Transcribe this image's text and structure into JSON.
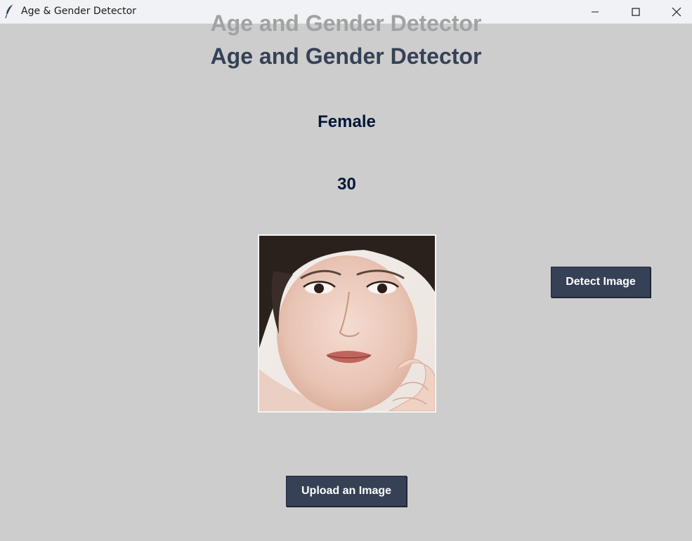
{
  "window": {
    "title": "Age & Gender Detector",
    "icon": "feather-icon",
    "controls": [
      "minimize-icon",
      "maximize-icon",
      "close-icon"
    ]
  },
  "app": {
    "heading": "Age and Gender Detector",
    "gender_result": "Female",
    "age_result": "30",
    "detect_button_label": "Detect Image",
    "upload_button_label": "Upload an Image"
  },
  "colors": {
    "background": "#cdcdcd",
    "heading": "#364156",
    "result_text": "#011638",
    "button_bg": "#364156",
    "button_text": "#ffffff"
  }
}
